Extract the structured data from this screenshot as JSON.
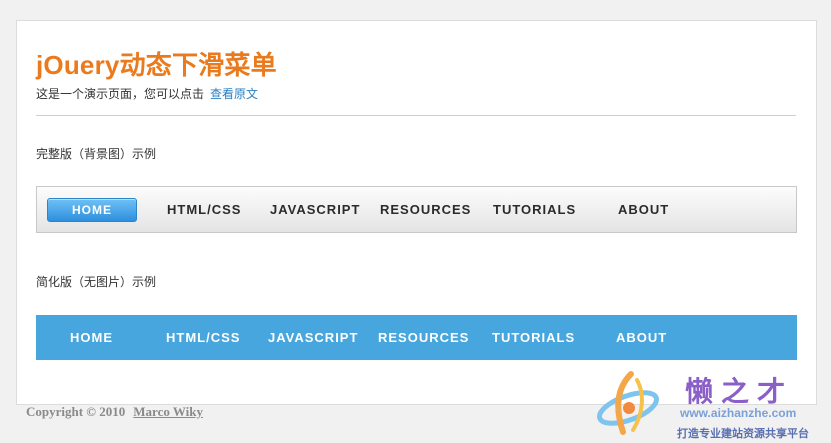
{
  "header": {
    "title": "jOuery动态下滑菜单",
    "subtitle_text": "这是一个演示页面，您可以点击",
    "subtitle_link": "查看原文"
  },
  "sections": {
    "full_label": "完整版（背景图）示例",
    "simple_label": "简化版（无图片）示例"
  },
  "menu_full": {
    "items": [
      "HOME",
      "HTML/CSS",
      "JAVASCRIPT",
      "RESOURCES",
      "TUTORIALS",
      "ABOUT"
    ],
    "active_index": 0
  },
  "menu_simple": {
    "items": [
      "HOME",
      "HTML/CSS",
      "JAVASCRIPT",
      "RESOURCES",
      "TUTORIALS",
      "ABOUT"
    ]
  },
  "footer": {
    "copyright": "Copyright © 2010",
    "author": "Marco Wiky"
  },
  "watermark": {
    "name": "懒之才",
    "url": "www.aizhanzhe.com",
    "slogan": "打造专业建站资源共享平台"
  },
  "colors": {
    "title": "#ea7a1c",
    "link": "#2a7fc1",
    "menu_blue": "#47a6dd",
    "active_blue": "#2d8fdf"
  }
}
